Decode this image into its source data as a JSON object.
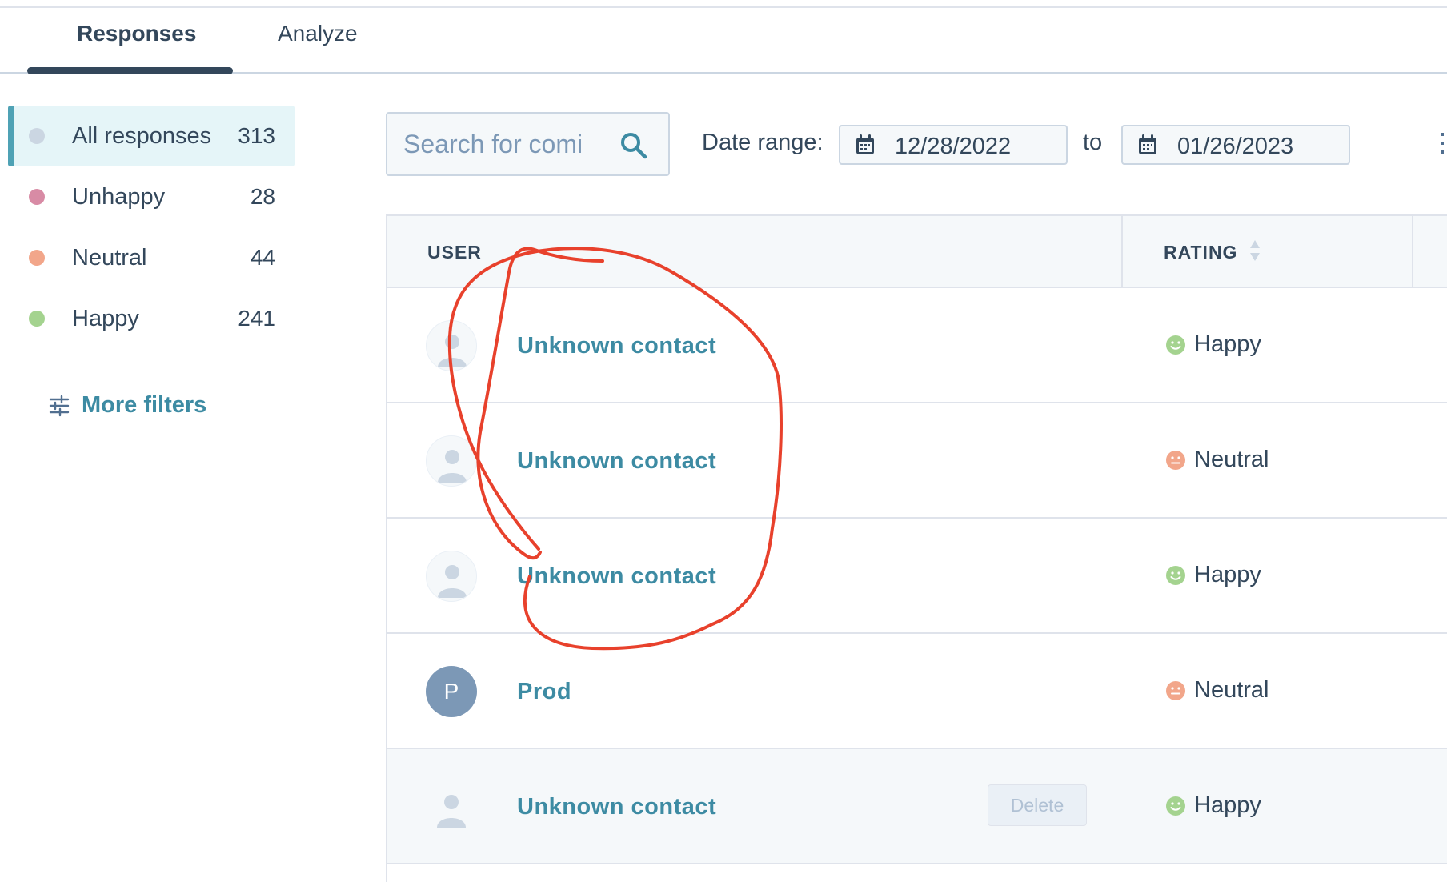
{
  "tabs": [
    {
      "label": "Responses",
      "active": true
    },
    {
      "label": "Analyze",
      "active": false
    }
  ],
  "sidebar": {
    "items": [
      {
        "label": "All responses",
        "count": "313",
        "color": "#cbd6e2",
        "active": true
      },
      {
        "label": "Unhappy",
        "count": "28",
        "color": "#d88ba5"
      },
      {
        "label": "Neutral",
        "count": "44",
        "color": "#f2a68a"
      },
      {
        "label": "Happy",
        "count": "241",
        "color": "#a4d38f"
      }
    ],
    "more_filters_label": "More filters"
  },
  "toolbar": {
    "search_placeholder": "Search for comi",
    "date_range_label": "Date range:",
    "start_date": "12/28/2022",
    "to_label": "to",
    "end_date": "01/26/2023"
  },
  "table": {
    "columns": {
      "user": "USER",
      "rating": "RATING"
    },
    "rows": [
      {
        "name": "Unknown contact",
        "rating": "Happy",
        "rating_icon": "happy-face-icon"
      },
      {
        "name": "Unknown contact",
        "rating": "Neutral",
        "rating_icon": "neutral-face-icon"
      },
      {
        "name": "Unknown contact",
        "rating": "Happy",
        "rating_icon": "happy-face-icon"
      },
      {
        "name": "Prod",
        "avatar_initial": "P",
        "rating": "Neutral",
        "rating_icon": "neutral-face-icon"
      },
      {
        "name": "Unknown contact",
        "rating": "Happy",
        "rating_icon": "happy-face-icon",
        "delete_label": "Delete"
      }
    ]
  },
  "colors": {
    "accent": "#3d8ba3",
    "text": "#33475b",
    "happy": "#a4d38f",
    "neutral": "#f2a68a",
    "annotation": "#e8412c"
  }
}
